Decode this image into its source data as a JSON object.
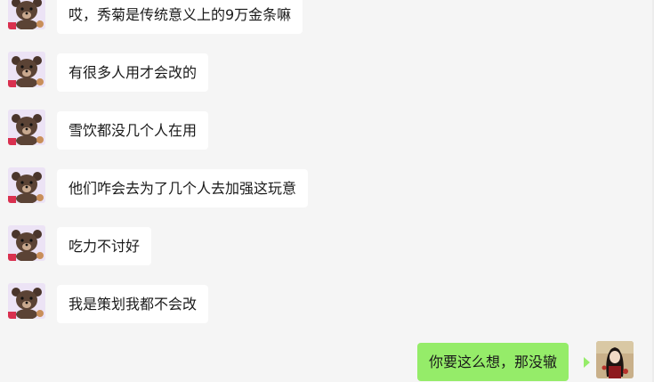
{
  "colors": {
    "background": "#f5f5f5",
    "incoming_bubble": "#ffffff",
    "outgoing_bubble": "#95ec69",
    "text": "#1a1a1a"
  },
  "messages": [
    {
      "sender": "other",
      "avatar": "bear-avatar-icon",
      "text": "哎，秀菊是传统意义上的9万金条嘛"
    },
    {
      "sender": "other",
      "avatar": "bear-avatar-icon",
      "text": "有很多人用才会改的"
    },
    {
      "sender": "other",
      "avatar": "bear-avatar-icon",
      "text": "雪饮都没几个人在用"
    },
    {
      "sender": "other",
      "avatar": "bear-avatar-icon",
      "text": "他们咋会去为了几个人去加强这玩意"
    },
    {
      "sender": "other",
      "avatar": "bear-avatar-icon",
      "text": "吃力不讨好"
    },
    {
      "sender": "other",
      "avatar": "bear-avatar-icon",
      "text": "我是策划我都不会改"
    },
    {
      "sender": "me",
      "avatar": "user-avatar-icon",
      "text": "你要这么想，那没辙"
    }
  ]
}
